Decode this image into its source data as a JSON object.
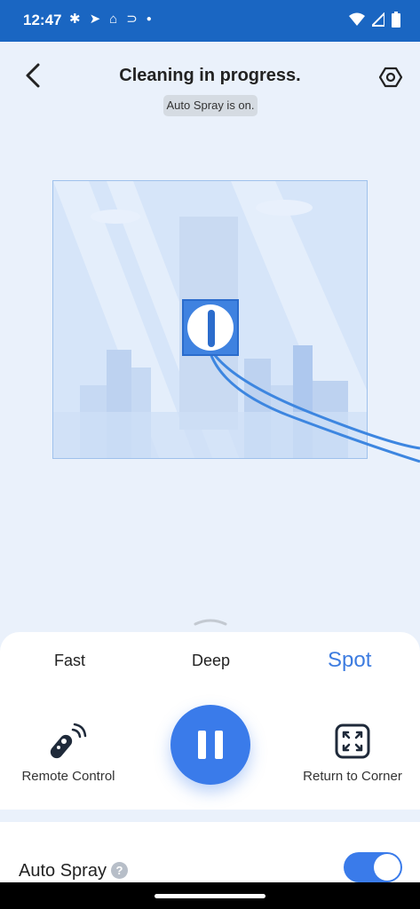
{
  "status_bar": {
    "time": "12:47"
  },
  "header": {
    "title": "Cleaning in progress.",
    "badge": "Auto Spray is on."
  },
  "modes": {
    "fast": "Fast",
    "deep": "Deep",
    "spot": "Spot",
    "active": "Spot"
  },
  "actions": {
    "remote_control": "Remote Control",
    "return_to_corner": "Return to Corner"
  },
  "settings": {
    "auto_spray_label": "Auto Spray",
    "auto_spray_on": true
  },
  "colors": {
    "status_bar": "#1a66c2",
    "accent": "#3a7bea",
    "background": "#eaf1fb"
  },
  "icons": [
    "back-icon",
    "settings-icon",
    "remote-control-icon",
    "pause-icon",
    "return-to-corner-icon",
    "help-icon"
  ]
}
